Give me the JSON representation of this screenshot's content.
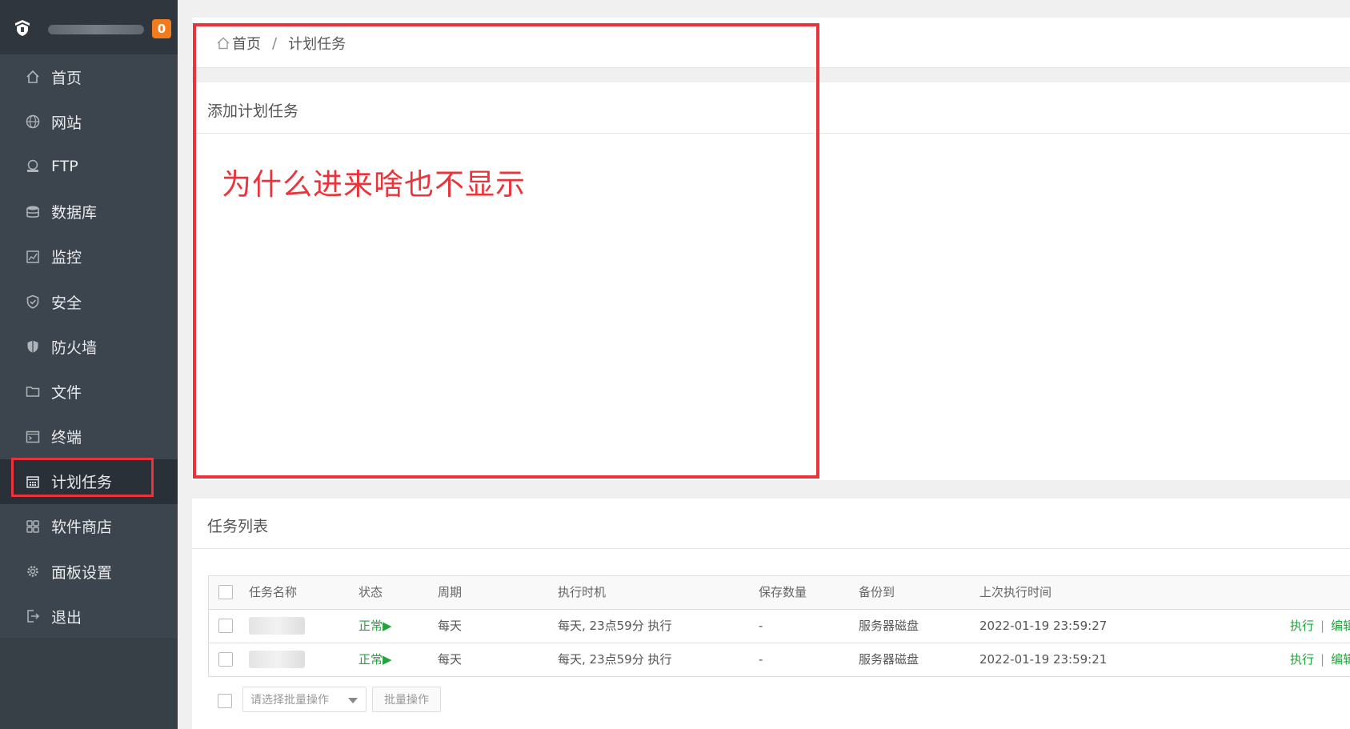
{
  "sidebar": {
    "badge_count": "0",
    "items": [
      {
        "label": "首页",
        "icon": "home-icon"
      },
      {
        "label": "网站",
        "icon": "globe-icon"
      },
      {
        "label": "FTP",
        "icon": "ftp-icon"
      },
      {
        "label": "数据库",
        "icon": "database-icon"
      },
      {
        "label": "监控",
        "icon": "monitor-icon"
      },
      {
        "label": "安全",
        "icon": "shield-icon"
      },
      {
        "label": "防火墙",
        "icon": "firewall-icon"
      },
      {
        "label": "文件",
        "icon": "folder-icon"
      },
      {
        "label": "终端",
        "icon": "terminal-icon"
      },
      {
        "label": "计划任务",
        "icon": "calendar-icon"
      },
      {
        "label": "软件商店",
        "icon": "apps-icon"
      },
      {
        "label": "面板设置",
        "icon": "gear-icon"
      },
      {
        "label": "退出",
        "icon": "logout-icon"
      }
    ],
    "active_index": 9
  },
  "breadcrumb": {
    "home": "首页",
    "separator": "/",
    "current": "计划任务"
  },
  "add_panel": {
    "title": "添加计划任务"
  },
  "annotation": {
    "text": "为什么进来啥也不显示",
    "color": "#e8343a"
  },
  "task_panel": {
    "title": "任务列表",
    "columns": [
      "任务名称",
      "状态",
      "周期",
      "执行时机",
      "保存数量",
      "备份到",
      "上次执行时间"
    ],
    "rows": [
      {
        "status": "正常▶",
        "period": "每天",
        "exec_time": "每天, 23点59分 执行",
        "save_count": "-",
        "backup_to": "服务器磁盘",
        "last_run": "2022-01-19 23:59:27",
        "op_run": "执行",
        "op_sep": "|",
        "op_edit": "编辑"
      },
      {
        "status": "正常▶",
        "period": "每天",
        "exec_time": "每天, 23点59分 执行",
        "save_count": "-",
        "backup_to": "服务器磁盘",
        "last_run": "2022-01-19 23:59:21",
        "op_run": "执行",
        "op_sep": "|",
        "op_edit": "编辑"
      }
    ],
    "batch_select_placeholder": "请选择批量操作",
    "batch_button": "批量操作"
  },
  "colors": {
    "sidebar_bg": "#3c444d",
    "accent_green": "#20a53a",
    "badge_orange": "#f37b1d",
    "highlight_red": "#e8343a"
  }
}
